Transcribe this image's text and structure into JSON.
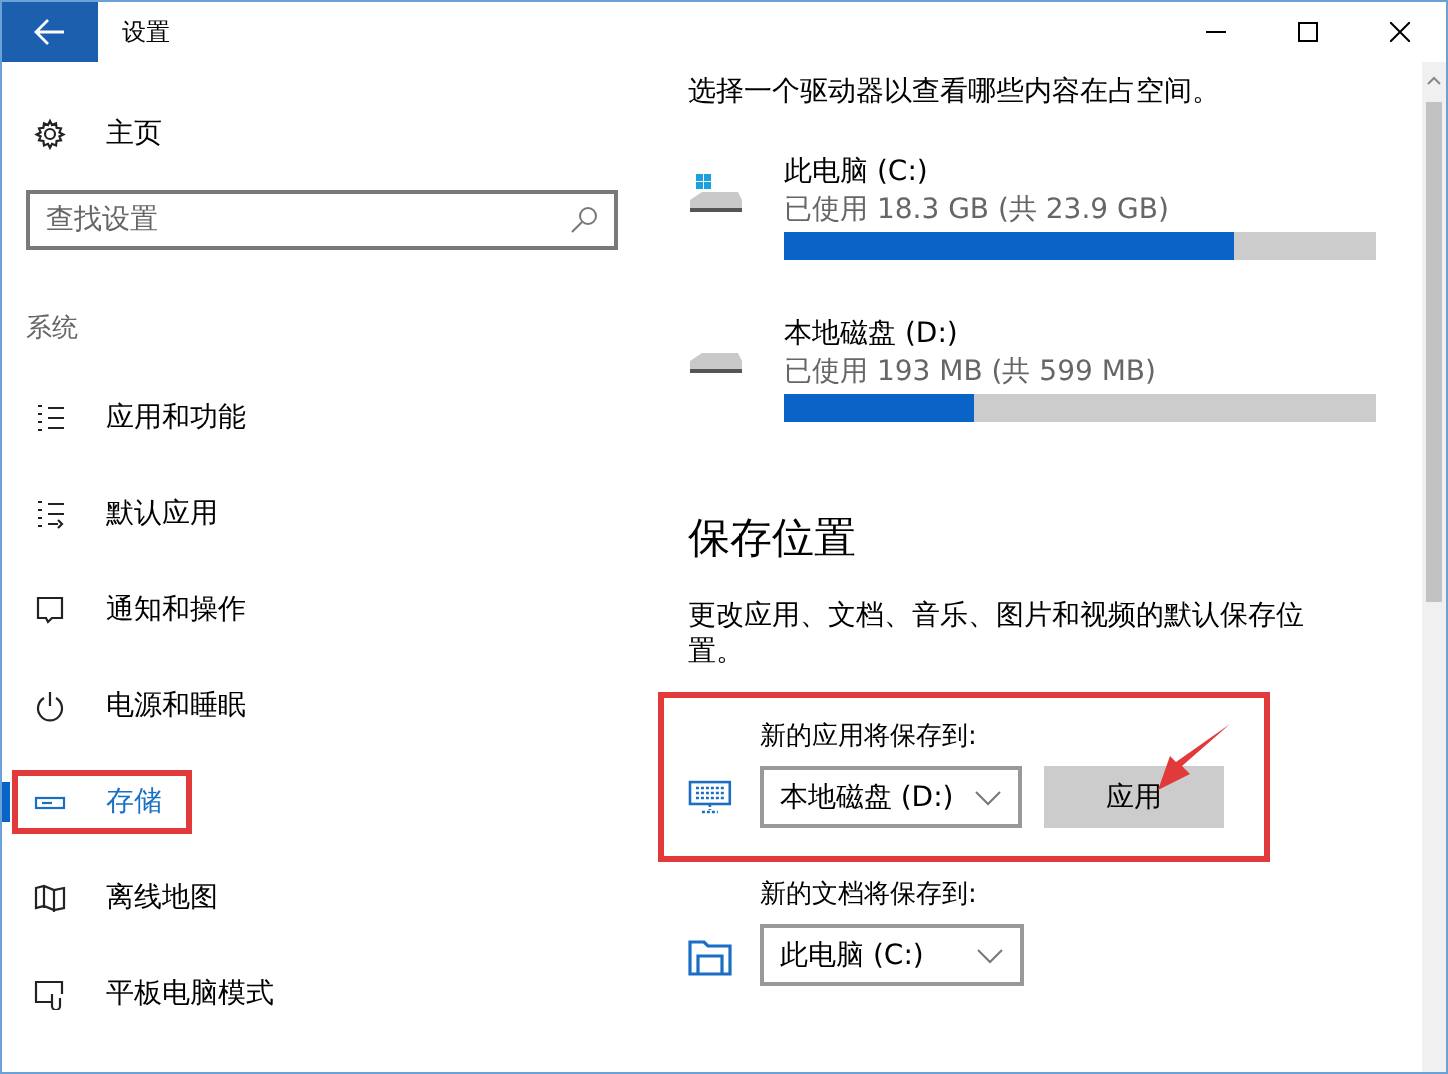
{
  "window": {
    "title": "设置"
  },
  "sidebar": {
    "home": "主页",
    "search": {
      "placeholder": "查找设置"
    },
    "section": "系统",
    "items": [
      {
        "label": "应用和功能",
        "kind": "apps",
        "selected": false,
        "highlighted": false
      },
      {
        "label": "默认应用",
        "kind": "defaults",
        "selected": false,
        "highlighted": false
      },
      {
        "label": "通知和操作",
        "kind": "notifications",
        "selected": false,
        "highlighted": false
      },
      {
        "label": "电源和睡眠",
        "kind": "power",
        "selected": false,
        "highlighted": false
      },
      {
        "label": "存储",
        "kind": "storage",
        "selected": true,
        "highlighted": true
      },
      {
        "label": "离线地图",
        "kind": "maps",
        "selected": false,
        "highlighted": false
      },
      {
        "label": "平板电脑模式",
        "kind": "tablet",
        "selected": false,
        "highlighted": false
      }
    ]
  },
  "storage": {
    "intro": "选择一个驱动器以查看哪些内容在占空间。",
    "drives": [
      {
        "name": "此电脑 (C:)",
        "kind": "system",
        "usage": "已使用 18.3 GB (共 23.9 GB)",
        "level": 0.76
      },
      {
        "name": "本地磁盘 (D:)",
        "kind": "local",
        "usage": "已使用 193 MB (共 599 MB)",
        "level": 0.32
      }
    ]
  },
  "save_locations": {
    "heading": "保存位置",
    "description": "更改应用、文档、音乐、图片和视频的默认保存位置。",
    "settings": [
      {
        "label": "新的应用将保存到:",
        "kind": "apps",
        "value": "本地磁盘 (D:)",
        "button": "应用",
        "highlighted": true
      },
      {
        "label": "新的文档将保存到:",
        "kind": "documents",
        "value": "此电脑 (C:)"
      }
    ]
  }
}
